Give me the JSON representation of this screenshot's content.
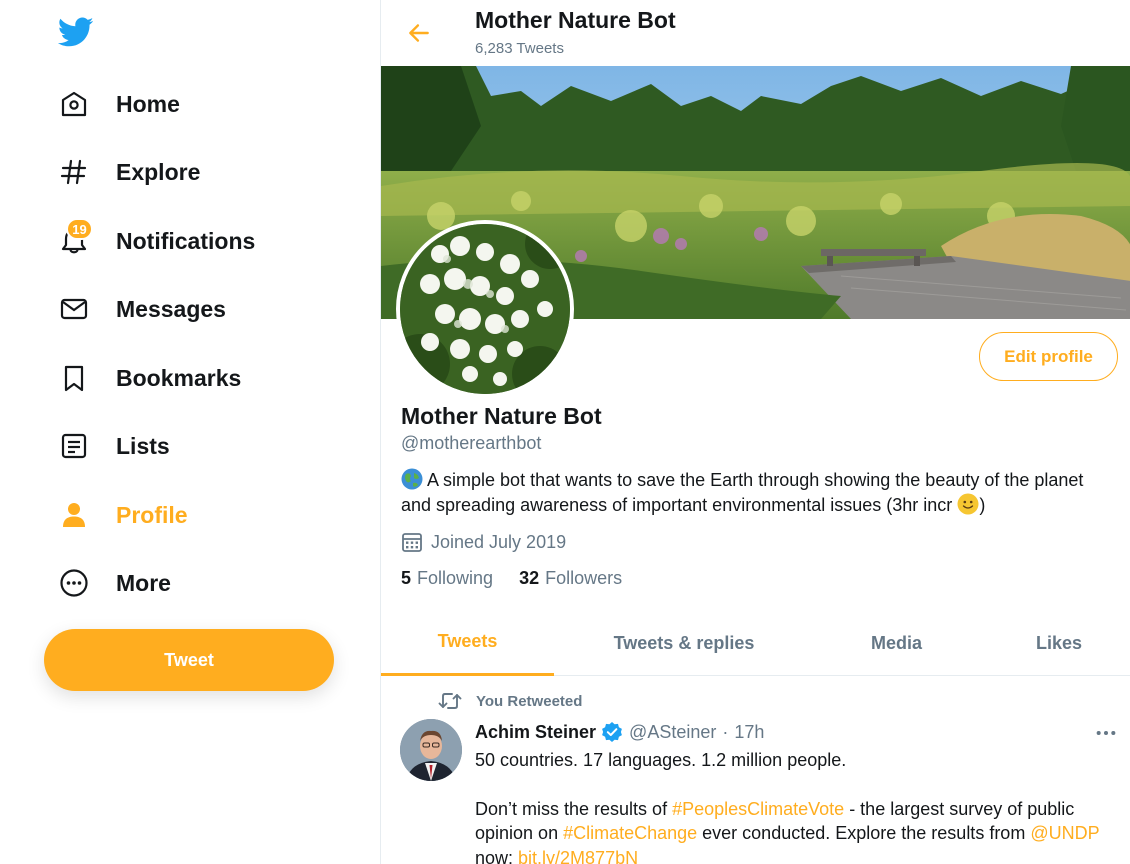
{
  "nav": {
    "items": [
      {
        "label": "Home",
        "icon": "home-icon"
      },
      {
        "label": "Explore",
        "icon": "hashtag-icon"
      },
      {
        "label": "Notifications",
        "icon": "bell-icon",
        "badge": "19"
      },
      {
        "label": "Messages",
        "icon": "envelope-icon"
      },
      {
        "label": "Bookmarks",
        "icon": "bookmark-icon"
      },
      {
        "label": "Lists",
        "icon": "list-icon"
      },
      {
        "label": "Profile",
        "icon": "person-icon",
        "active": true
      },
      {
        "label": "More",
        "icon": "more-circle-icon"
      }
    ],
    "tweet_button": "Tweet"
  },
  "header": {
    "title": "Mother Nature Bot",
    "subtitle": "6,283 Tweets"
  },
  "profile": {
    "name": "Mother Nature Bot",
    "handle": "@motherearthbot",
    "bio": "A simple bot that wants to save the Earth through showing the beauty of the planet and spreading awareness of important environmental issues (3hr incr",
    "bio_end": ")",
    "joined": "Joined July 2019",
    "following_count": "5",
    "following_label": "Following",
    "followers_count": "32",
    "followers_label": "Followers",
    "edit_button": "Edit profile"
  },
  "tabs": [
    {
      "label": "Tweets",
      "active": true
    },
    {
      "label": "Tweets & replies"
    },
    {
      "label": "Media"
    },
    {
      "label": "Likes"
    }
  ],
  "tweet": {
    "retweet_label": "You Retweeted",
    "author_name": "Achim Steiner",
    "author_handle": "@ASteiner",
    "time": "17h",
    "line1": "50 countries. 17 languages. 1.2 million people.",
    "p2_a": "Don’t miss the results of ",
    "p2_tag1": "#PeoplesClimateVote",
    "p2_b": " - the largest survey of public opinion on ",
    "p2_tag2": "#ClimateChange",
    "p2_c": " ever conducted. Explore the results from ",
    "p2_mention": "@UNDP",
    "p2_d": " now: ",
    "p2_link": "bit.ly/2M877bN"
  },
  "colors": {
    "accent": "#ffad1f",
    "logo": "#1da1f2",
    "secondary_text": "#657786",
    "verified": "#1da1f2"
  }
}
